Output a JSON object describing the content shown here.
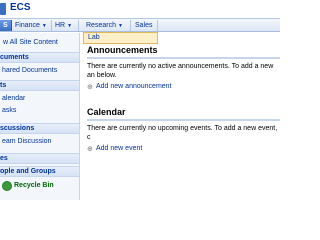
{
  "site": {
    "title": "ECS"
  },
  "topnav": {
    "tabs": [
      {
        "label": "S",
        "active": true,
        "caret": false
      },
      {
        "label": "Finance",
        "active": false,
        "caret": true
      },
      {
        "label": "HR",
        "active": false,
        "caret": true
      },
      {
        "label": "Research",
        "active": false,
        "caret": true
      },
      {
        "label": "Sales",
        "active": false,
        "caret": false
      }
    ],
    "caret_glyph": "▼",
    "dropdown_item": "Lab"
  },
  "leftnav": {
    "view_all": "w All Site Content",
    "sections": [
      {
        "heading": "cuments",
        "items": [
          "hared Documents"
        ]
      },
      {
        "heading": "ts",
        "items": [
          "alendar",
          "asks"
        ]
      },
      {
        "heading": "scussions",
        "items": [
          "eam Discussion"
        ]
      },
      {
        "heading": "es",
        "items": []
      },
      {
        "heading": "ople and Groups",
        "items": []
      }
    ],
    "recycle_bin": "Recycle Bin"
  },
  "main": {
    "announcements": {
      "title": "Announcements",
      "empty_text": "There are currently no active announcements. To add a new an below.",
      "add_link": "Add new announcement"
    },
    "calendar": {
      "title": "Calendar",
      "empty_text": "There are currently no upcoming events. To add a new event, c",
      "add_link": "Add new event"
    },
    "plus_glyph": "⊕"
  },
  "colors": {
    "accent": "#3a6fc4",
    "link": "#003399",
    "dropdown_bg": "#fbf0c8",
    "recycle": "#006600"
  }
}
